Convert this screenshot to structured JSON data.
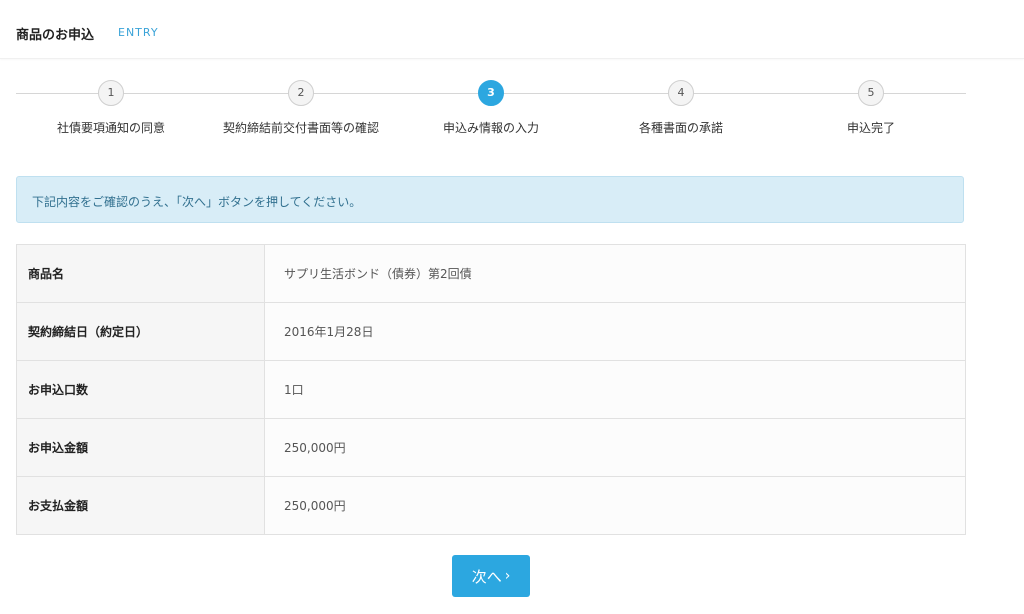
{
  "header": {
    "title": "商品のお申込",
    "subtitle": "ENTRY"
  },
  "steps": [
    {
      "number": "1",
      "label": "社債要項通知の同意",
      "active": false
    },
    {
      "number": "2",
      "label": "契約締結前交付書面等の確認",
      "active": false
    },
    {
      "number": "3",
      "label": "申込み情報の入力",
      "active": true
    },
    {
      "number": "4",
      "label": "各種書面の承諾",
      "active": false
    },
    {
      "number": "5",
      "label": "申込完了",
      "active": false
    }
  ],
  "info_message": "下記内容をご確認のうえ、「次へ」ボタンを押してください。",
  "details": [
    {
      "label": "商品名",
      "value": "サプリ生活ボンド（債券）第2回債"
    },
    {
      "label": "契約締結日（約定日）",
      "value": "2016年1月28日"
    },
    {
      "label": "お申込口数",
      "value": "1口"
    },
    {
      "label": "お申込金額",
      "value": "250,000円"
    },
    {
      "label": "お支払金額",
      "value": "250,000円"
    }
  ],
  "next_button": {
    "label": "次へ",
    "icon": "chevron-right-icon"
  },
  "colors": {
    "accent": "#2ca7e0",
    "info_bg": "#d8edf7",
    "info_text": "#31708f"
  }
}
